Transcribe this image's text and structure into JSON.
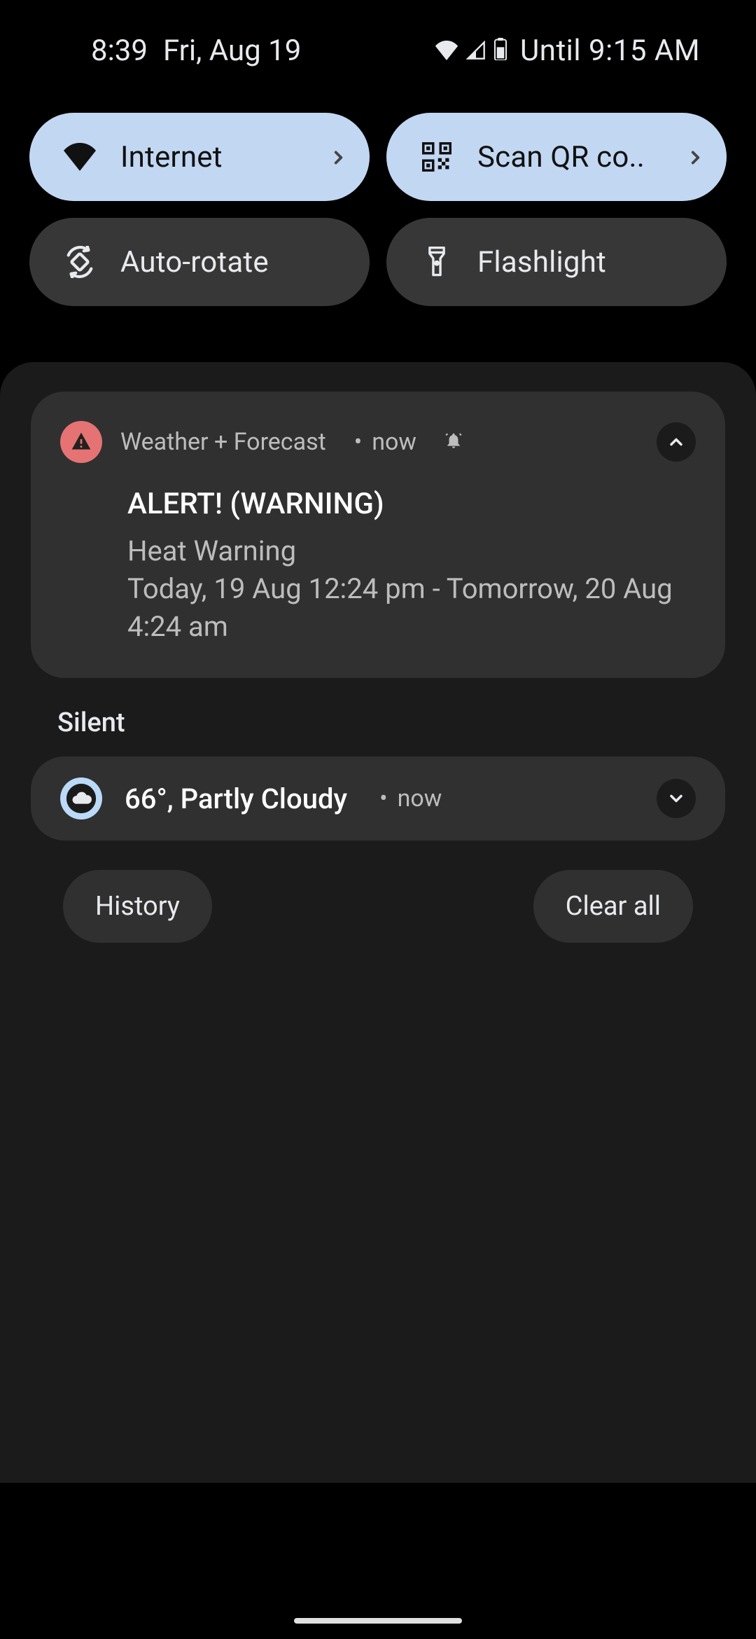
{
  "status": {
    "time": "8:39",
    "date": "Fri, Aug 19",
    "battery_label": "Until 9:15 AM"
  },
  "quick_settings": {
    "tiles": [
      {
        "label": "Internet",
        "state": "active",
        "icon": "wifi-icon",
        "has_chevron": true
      },
      {
        "label": "Scan QR co..",
        "state": "active",
        "icon": "qr-icon",
        "has_chevron": true
      },
      {
        "label": "Auto-rotate",
        "state": "inactive",
        "icon": "autorotate-icon",
        "has_chevron": false
      },
      {
        "label": "Flashlight",
        "state": "inactive",
        "icon": "flashlight-icon",
        "has_chevron": false
      }
    ]
  },
  "notifications": {
    "alert": {
      "app_name": "Weather + Forecast",
      "time": "now",
      "title": "ALERT! (WARNING)",
      "body_line1": "Heat Warning",
      "body_line2": "Today,  19 Aug 12:24 pm - Tomorrow,  20 Aug 4:24 am"
    },
    "silent_label": "Silent",
    "weather": {
      "title": "66°, Partly Cloudy",
      "time": "now"
    }
  },
  "actions": {
    "history": "History",
    "clear_all": "Clear all"
  }
}
